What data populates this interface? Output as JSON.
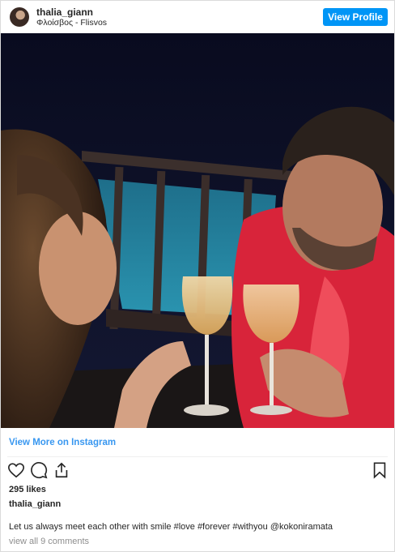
{
  "header": {
    "username": "thalia_giann",
    "location": "Φλοίσβος - Flisvos",
    "view_profile_label": "View Profile"
  },
  "view_more_label": "View More on Instagram",
  "actions": {
    "like_icon": "heart-icon",
    "comment_icon": "comment-icon",
    "share_icon": "share-icon",
    "save_icon": "bookmark-icon"
  },
  "likes": "295 likes",
  "owner": "thalia_giann",
  "caption": "Let us always meet each other with smile #love #forever #withyou @kokoniramata",
  "comments_link": "view all 9 comments",
  "colors": {
    "accent": "#0095f6",
    "link": "#3897f0",
    "text": "#262626",
    "muted": "#8e8e8e",
    "border": "#dbdbdb"
  }
}
